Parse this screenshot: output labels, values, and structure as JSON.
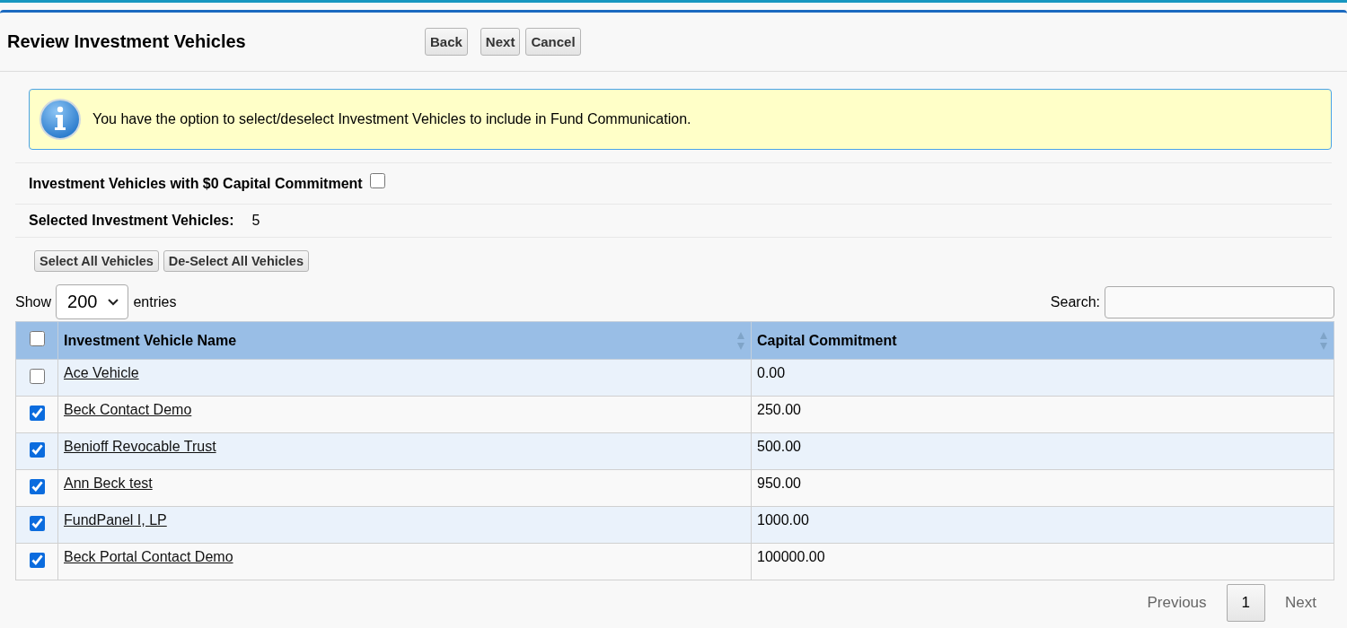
{
  "header": {
    "title": "Review Investment Vehicles",
    "buttons": [
      "Back",
      "Next",
      "Cancel"
    ]
  },
  "info": {
    "message": "You have the option to select/deselect Investment Vehicles to include in Fund Communication."
  },
  "zero_commitment": {
    "label": "Investment Vehicles with $0 Capital Commitment",
    "checked": false
  },
  "selected_count": {
    "label": "Selected Investment Vehicles:",
    "value": "5"
  },
  "bulk_buttons": [
    "Select All Vehicles",
    "De-Select All Vehicles"
  ],
  "length": {
    "show": "Show",
    "value": "200",
    "entries": "entries"
  },
  "search": {
    "label": "Search:"
  },
  "table": {
    "select_all_checked": false,
    "columns": [
      "Investment Vehicle Name",
      "Capital Commitment"
    ],
    "rows": [
      {
        "checked": false,
        "name": "Ace Vehicle",
        "commitment": "0.00"
      },
      {
        "checked": true,
        "name": "Beck Contact Demo",
        "commitment": "250.00"
      },
      {
        "checked": true,
        "name": "Benioff Revocable Trust",
        "commitment": "500.00"
      },
      {
        "checked": true,
        "name": "Ann Beck test",
        "commitment": "950.00"
      },
      {
        "checked": true,
        "name": "FundPanel I, LP",
        "commitment": "1000.00"
      },
      {
        "checked": true,
        "name": "Beck Portal Contact Demo",
        "commitment": "100000.00"
      }
    ]
  },
  "pagination": {
    "previous": {
      "label": "Previous",
      "disabled": true
    },
    "pages": [
      {
        "label": "1",
        "selected": true
      }
    ],
    "next": {
      "label": "Next",
      "disabled": true
    }
  }
}
